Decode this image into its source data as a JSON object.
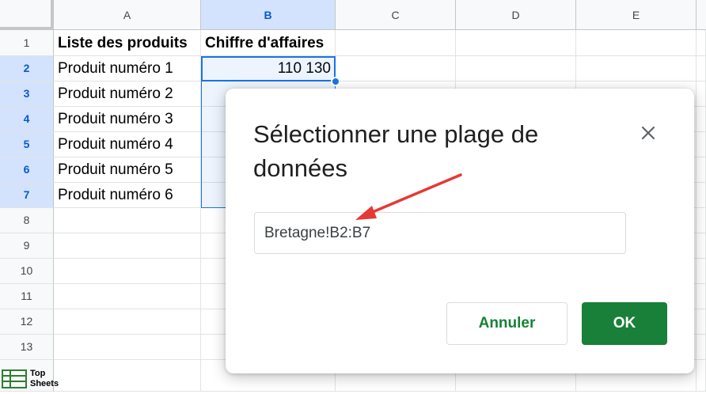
{
  "columns": [
    "A",
    "B",
    "C",
    "D",
    "E"
  ],
  "rows": [
    "1",
    "2",
    "3",
    "4",
    "5",
    "6",
    "7",
    "8",
    "9",
    "10",
    "11",
    "12",
    "13"
  ],
  "header_row": {
    "a": "Liste des produits",
    "b": "Chiffre d'affaires"
  },
  "products": [
    "Produit numéro 1",
    "Produit numéro 2",
    "Produit numéro 3",
    "Produit numéro 4",
    "Produit numéro 5",
    "Produit numéro 6"
  ],
  "b2_value": "110 130",
  "dialog": {
    "title": "Sélectionner une plage de données",
    "range_value": "Bretagne!B2:B7",
    "cancel_label": "Annuler",
    "ok_label": "OK"
  },
  "logo": {
    "line1": "Top",
    "line2": "Sheets"
  },
  "colors": {
    "accent": "#1a73e8",
    "ok_green": "#188038",
    "arrow": "#e53935"
  },
  "icons": {
    "close": "close-icon",
    "arrow": "red-arrow-annotation",
    "logo": "top-sheets-logo-icon"
  }
}
